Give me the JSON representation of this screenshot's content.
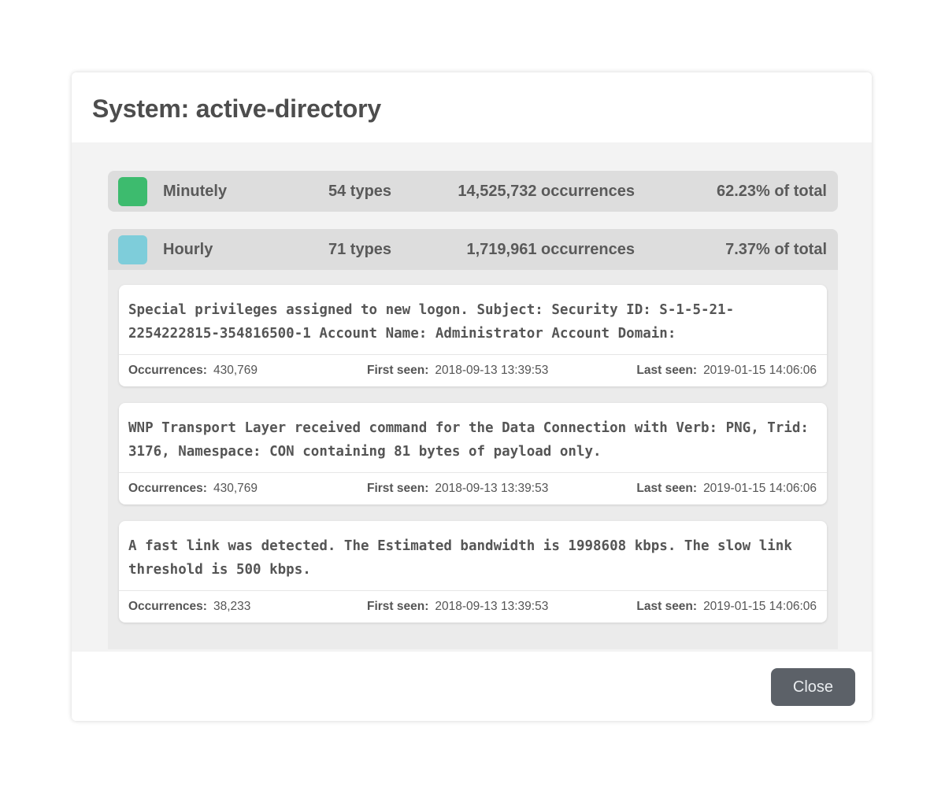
{
  "modal": {
    "title": "System: active-directory",
    "close_label": "Close"
  },
  "groups": [
    {
      "name": "Minutely",
      "types": "54 types",
      "occurrences": "14,525,732 occurrences",
      "percent": "62.23% of total",
      "color": "#3dbb6e",
      "expanded": false
    },
    {
      "name": "Hourly",
      "types": "71 types",
      "occurrences": "1,719,961 occurrences",
      "percent": "7.37% of total",
      "color": "#7ecdda",
      "expanded": true,
      "items": [
        {
          "message": "Special privileges assigned to new logon. Subject: Security ID: S-1-5-21-2254222815-354816500-1 Account Name: Administrator Account Domain:",
          "occurrences_label": "Occurrences:",
          "occurrences": "430,769",
          "first_seen_label": "First seen:",
          "first_seen": "2018-09-13 13:39:53",
          "last_seen_label": "Last seen:",
          "last_seen": "2019-01-15 14:06:06"
        },
        {
          "message": "WNP Transport Layer received command for the Data Connection with Verb: PNG, Trid: 3176, Namespace: CON containing 81 bytes of payload only.",
          "occurrences_label": "Occurrences:",
          "occurrences": "430,769",
          "first_seen_label": "First seen:",
          "first_seen": "2018-09-13 13:39:53",
          "last_seen_label": "Last seen:",
          "last_seen": "2019-01-15 14:06:06"
        },
        {
          "message": "A fast link was detected. The Estimated bandwidth is 1998608 kbps. The slow link threshold is 500 kbps.",
          "occurrences_label": "Occurrences:",
          "occurrences": "38,233",
          "first_seen_label": "First seen:",
          "first_seen": "2018-09-13 13:39:53",
          "last_seen_label": "Last seen:",
          "last_seen": "2019-01-15 14:06:06"
        }
      ]
    }
  ]
}
